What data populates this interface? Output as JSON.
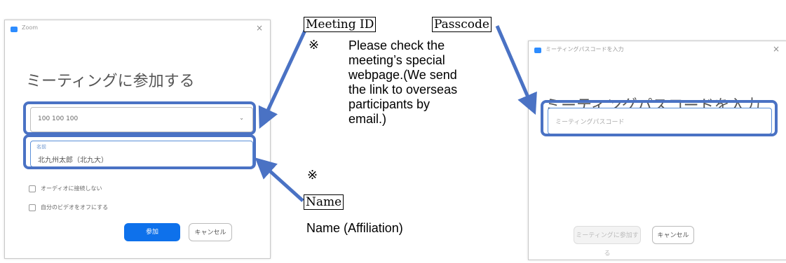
{
  "join_window": {
    "title": "Zoom",
    "close": "×",
    "heading": "ミーティングに参加する",
    "meeting_id_value": "100 100 100",
    "meeting_id_chevron": "⌄",
    "name_label": "名前",
    "name_value": "北九州太郎（北九大）",
    "audio_checkbox_label": "オーディオに接続しない",
    "video_checkbox_label": "自分のビデオをオフにする",
    "join_button": "参加",
    "cancel_button": "キャンセル"
  },
  "passcode_window": {
    "title": "ミーティングパスコードを入力",
    "close": "×",
    "heading": "ミーティングパスコードを入力",
    "passcode_placeholder": "ミーティングパスコード",
    "join_button": "ミーティングに参加する",
    "cancel_button": "キャンセル"
  },
  "annotations": {
    "meeting_id_label": "Meeting ID",
    "passcode_label": "Passcode",
    "note_mark_1": "※",
    "note_lines": [
      "Please check the",
      "meeting’s special",
      "webpage.(We send",
      "the link to overseas",
      "participants by",
      "email.)"
    ],
    "note_mark_2": "※",
    "name_label": "Name",
    "name_caption": "Name (Affiliation)"
  },
  "colors": {
    "highlight": "#4a72c4",
    "zoom_blue": "#0e71eb",
    "arrow": "#4a72c4"
  }
}
